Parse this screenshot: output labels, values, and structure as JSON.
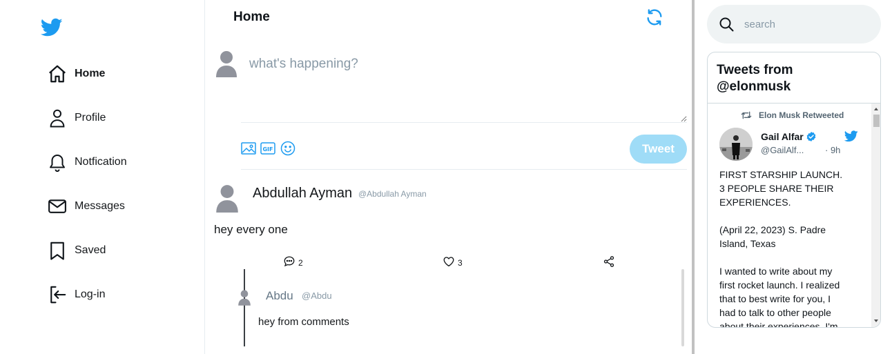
{
  "sidebar": {
    "items": [
      {
        "label": "Home",
        "icon": "home-icon",
        "active": true
      },
      {
        "label": "Profile",
        "icon": "user-icon",
        "active": false
      },
      {
        "label": "Notfication",
        "icon": "bell-icon",
        "active": false
      },
      {
        "label": "Messages",
        "icon": "mail-icon",
        "active": false
      },
      {
        "label": "Saved",
        "icon": "bookmark-icon",
        "active": false
      },
      {
        "label": "Log-in",
        "icon": "login-icon",
        "active": false
      }
    ]
  },
  "feed": {
    "title": "Home",
    "composer": {
      "placeholder": "what's happening?",
      "tweet_label": "Tweet",
      "tools": [
        "image-icon",
        "gif-icon",
        "emoji-icon"
      ]
    },
    "post": {
      "name": "Abdullah Ayman",
      "handle": "@Abdullah Ayman",
      "text": "hey every one",
      "comments": "2",
      "likes": "3"
    },
    "comment": {
      "name": "Abdu",
      "handle": "@Abdu",
      "text": "hey from comments"
    }
  },
  "search": {
    "placeholder": "search"
  },
  "timeline": {
    "title": "Tweets from @elonmusk",
    "retweet_label": "Elon Musk Retweeted",
    "tweet": {
      "name": "Gail Alfar",
      "handle": "@GailAlf...",
      "time": "· 9h",
      "lines": [
        "FIRST STARSHIP LAUNCH.",
        "3 PEOPLE  SHARE THEIR",
        "EXPERIENCES.",
        "",
        "(April 22, 2023) S. Padre",
        "Island, Texas",
        "",
        "I wanted to write about my",
        "first rocket launch. I realized",
        "that to best write for you, I",
        "had to talk to other people",
        "about their experiences.  I'm"
      ]
    }
  },
  "colors": {
    "accent": "#1d9bf0",
    "tweet_button": "#9fdcf7",
    "muted_text": "#8899a6",
    "border": "#e6ecf0"
  }
}
